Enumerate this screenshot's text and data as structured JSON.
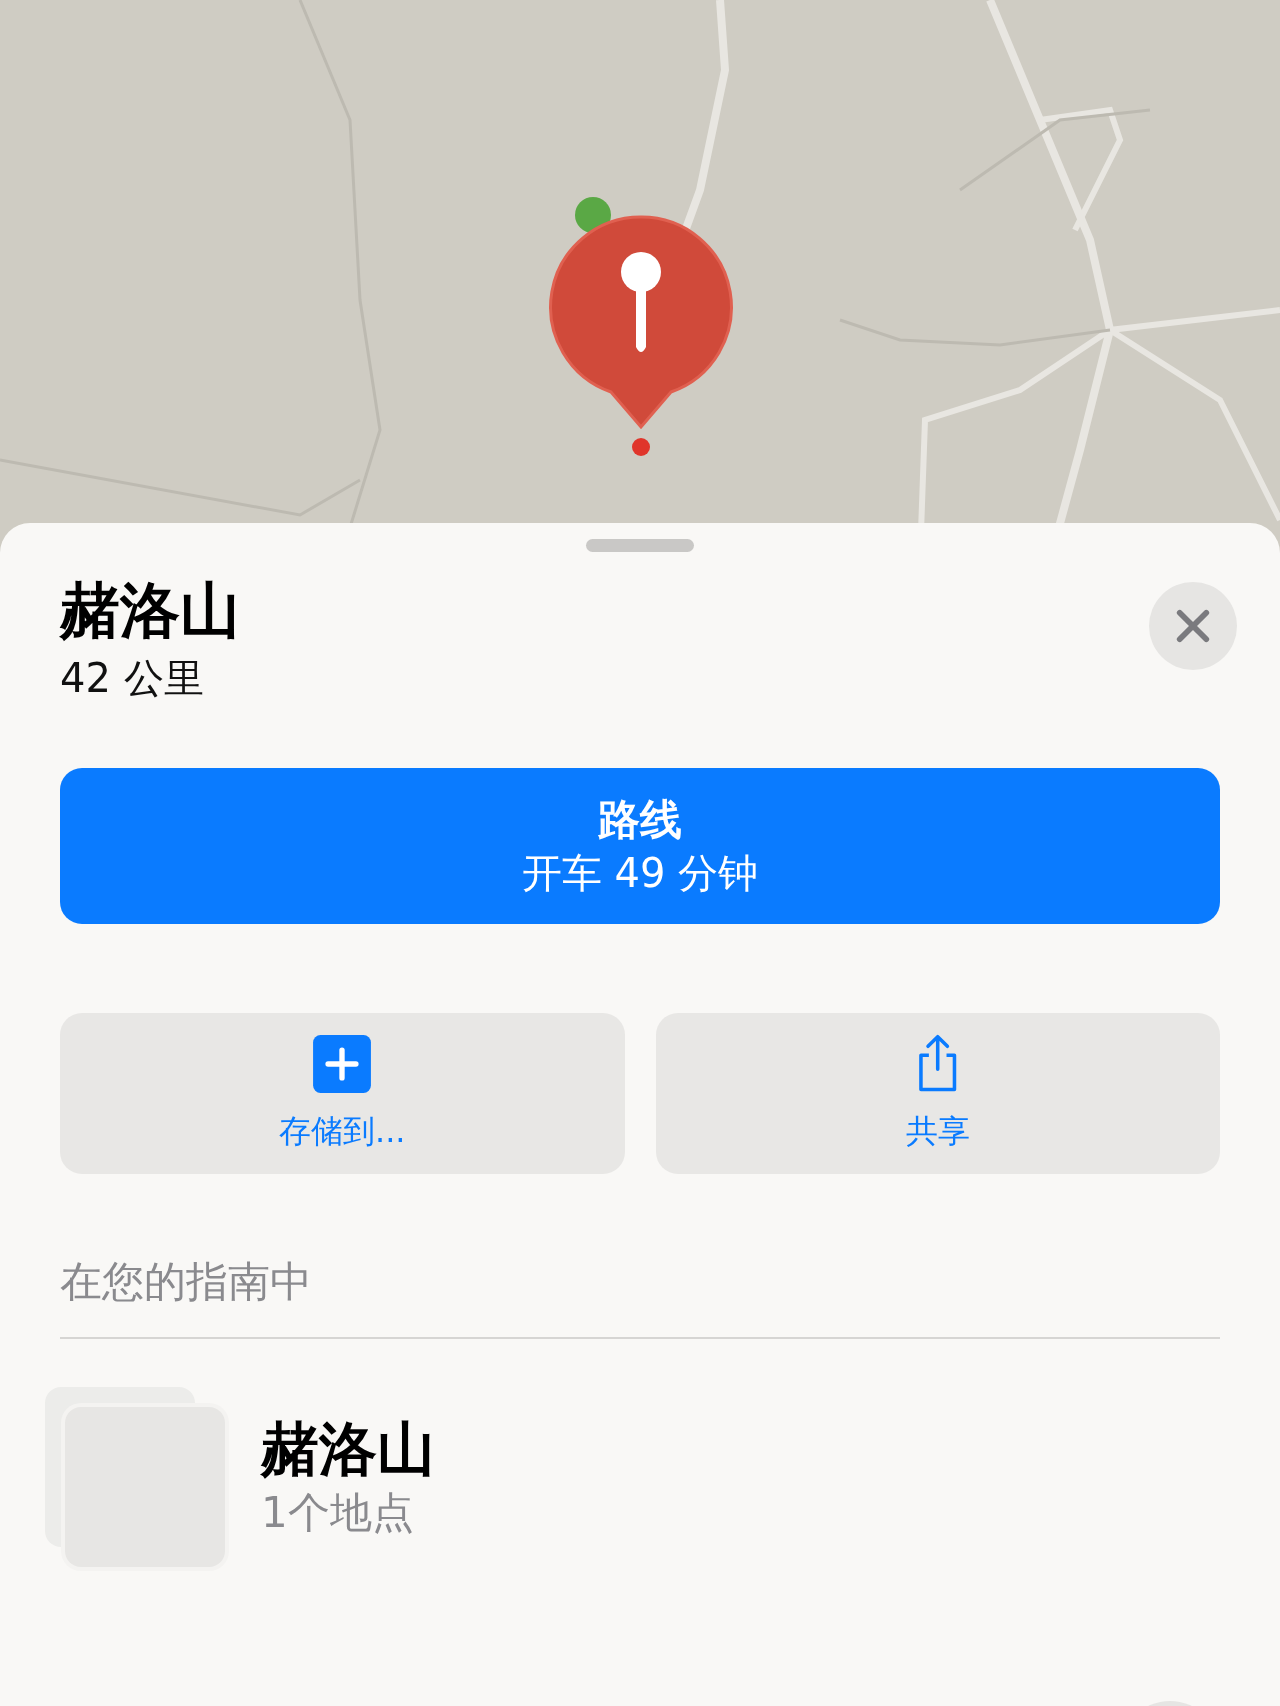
{
  "place": {
    "title": "赭洛山",
    "distance": "42 公里"
  },
  "directions_button": {
    "label": "路线",
    "detail": "开车 49 分钟"
  },
  "actions": [
    {
      "kind": "save",
      "label": "存储到..."
    },
    {
      "kind": "share",
      "label": "共享"
    }
  ],
  "guides_section": {
    "heading": "在您的指南中",
    "items": [
      {
        "title": "赭洛山",
        "count": "1个地点"
      }
    ]
  }
}
